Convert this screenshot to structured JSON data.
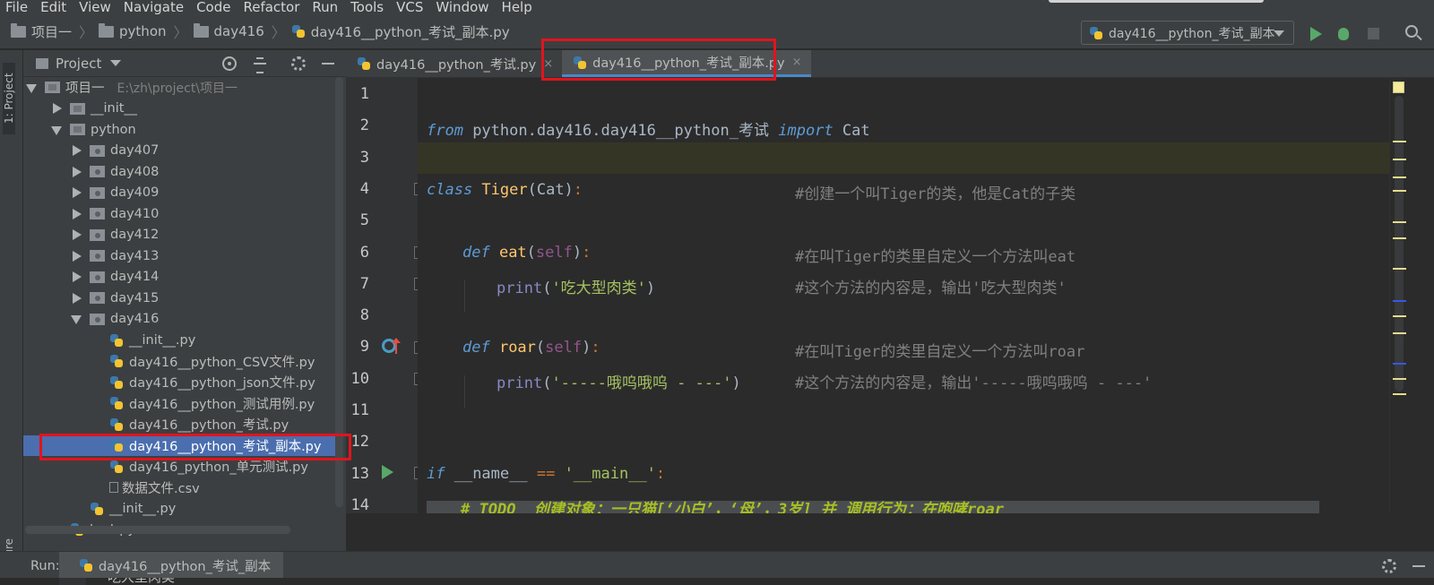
{
  "menu": [
    "File",
    "Edit",
    "View",
    "Navigate",
    "Code",
    "Refactor",
    "Run",
    "Tools",
    "VCS",
    "Window",
    "Help"
  ],
  "breadcrumb": [
    "项目一",
    "python",
    "day416",
    "day416__python_考试_副本.py"
  ],
  "run_config": "day416__python_考试_副本",
  "project_panel": {
    "title": "Project",
    "tree": [
      {
        "label": "项目一",
        "hint": "E:\\zh\\project\\项目一",
        "type": "folder",
        "expanded": true,
        "depth": 0
      },
      {
        "label": "__init__",
        "type": "folder",
        "expanded": false,
        "depth": 1
      },
      {
        "label": "python",
        "type": "folder",
        "expanded": true,
        "depth": 1
      },
      {
        "label": "day407",
        "type": "pkg",
        "expanded": false,
        "depth": 2
      },
      {
        "label": "day408",
        "type": "pkg",
        "expanded": false,
        "depth": 2
      },
      {
        "label": "day409",
        "type": "pkg",
        "expanded": false,
        "depth": 2
      },
      {
        "label": "day410",
        "type": "pkg",
        "expanded": false,
        "depth": 2
      },
      {
        "label": "day412",
        "type": "pkg",
        "expanded": false,
        "depth": 2
      },
      {
        "label": "day413",
        "type": "pkg",
        "expanded": false,
        "depth": 2
      },
      {
        "label": "day414",
        "type": "pkg",
        "expanded": false,
        "depth": 2
      },
      {
        "label": "day415",
        "type": "pkg",
        "expanded": false,
        "depth": 2
      },
      {
        "label": "day416",
        "type": "pkg",
        "expanded": true,
        "depth": 2
      },
      {
        "label": "__init__.py",
        "type": "py",
        "depth": 3
      },
      {
        "label": "day416__python_CSV文件.py",
        "type": "py",
        "depth": 3
      },
      {
        "label": "day416__python_json文件.py",
        "type": "py",
        "depth": 3
      },
      {
        "label": "day416__python_测试用例.py",
        "type": "py",
        "depth": 3
      },
      {
        "label": "day416__python_考试.py",
        "type": "py",
        "depth": 3
      },
      {
        "label": "day416__python_考试_副本.py",
        "type": "py",
        "depth": 3,
        "selected": true
      },
      {
        "label": "day416_python_单元测试.py",
        "type": "py",
        "depth": 3
      },
      {
        "label": "数据文件.csv",
        "type": "csv",
        "depth": 3
      },
      {
        "label": "__init__.py",
        "type": "py",
        "depth": 2
      },
      {
        "label": "text.py",
        "type": "py",
        "depth": 1
      }
    ]
  },
  "side_tabs": {
    "project": "1: Project",
    "structure": "Z: Structure"
  },
  "editor_tabs": [
    {
      "label": "day416__python_考试.py",
      "close": "×"
    },
    {
      "label": "day416__python_考试_副本.py",
      "close": "×",
      "active": true
    }
  ],
  "line_numbers": [
    "1",
    "2",
    "3",
    "4",
    "5",
    "6",
    "7",
    "8",
    "9",
    "10",
    "11",
    "12",
    "13",
    "14"
  ],
  "code": {
    "l2": {
      "from": "from",
      "mod": " python.day416.day416__python_考试 ",
      "imp": "import",
      "name": " Cat"
    },
    "l4": {
      "kw": "class",
      "name": " Tiger",
      "args": "(Cat)",
      "colon": ":",
      "cmt": "#创建一个叫Tiger的类，他是Cat的子类"
    },
    "l6": {
      "kw": "def",
      "name": " eat",
      "p1": "(",
      "self": "self",
      "p2": ")",
      "colon": ":",
      "cmt": "#在叫Tiger的类里自定义一个方法叫eat"
    },
    "l7": {
      "fn": "print",
      "p1": "(",
      "str": "'吃大型肉类'",
      "p2": ")",
      "cmt": "#这个方法的内容是，输出'吃大型肉类'"
    },
    "l9": {
      "kw": "def",
      "name": " roar",
      "p1": "(",
      "self": "self",
      "p2": ")",
      "colon": ":",
      "cmt": "#在叫Tiger的类里自定义一个方法叫roar"
    },
    "l10": {
      "fn": "print",
      "p1": "(",
      "str": "'-----哦呜哦呜 - ---'",
      "p2": ")",
      "cmt": "#这个方法的内容是，输出'-----哦呜哦呜 - ---'"
    },
    "l13": {
      "kw": "if",
      "name": " __name__ ",
      "eq": "==",
      "str": " '__main__'",
      "colon": ":"
    },
    "l14": {
      "hash": "#",
      "todo": " TODO  创建对象：一只猫[‘小白’，‘母’，3岁] 并 调用行为：在咆哮roar"
    }
  },
  "run_panel": {
    "label": "Run:",
    "tab": "day416__python_考试_副本",
    "output": "吃大型肉类"
  },
  "colors": {
    "keyword": "#5e9bd6",
    "string": "#a5c261",
    "comment": "#808080",
    "selection": "#4b6eaf",
    "highlight_box": "#e0141e",
    "run": "#59a869"
  }
}
